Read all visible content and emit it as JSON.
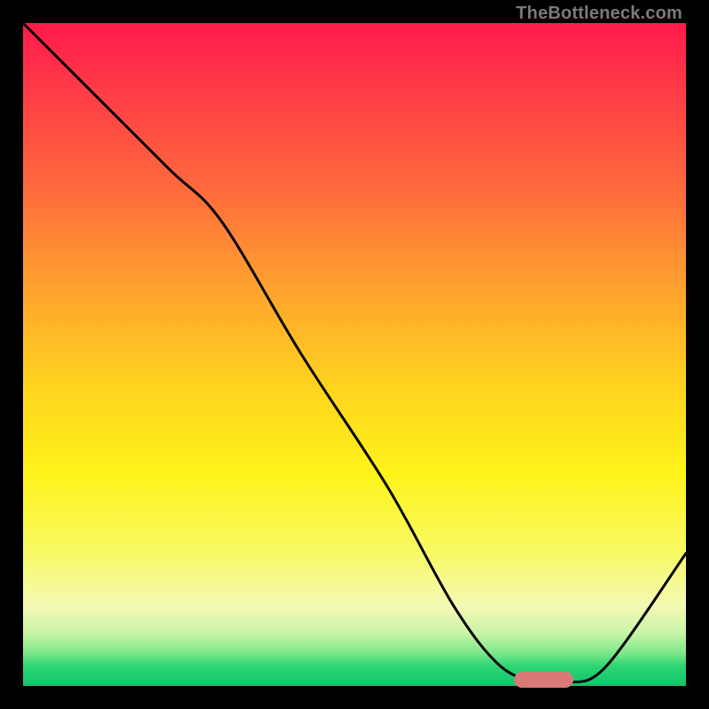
{
  "watermark": "TheBottleneck.com",
  "colors": {
    "frame": "#000000",
    "curve": "#000000",
    "marker": "#d97a78"
  },
  "chart_data": {
    "type": "line",
    "title": "",
    "xlabel": "",
    "ylabel": "",
    "xlim": [
      0,
      100
    ],
    "ylim": [
      0,
      100
    ],
    "grid": false,
    "series": [
      {
        "name": "curve",
        "x": [
          0,
          10,
          22,
          30,
          42,
          55,
          65,
          72,
          78,
          82,
          88,
          100
        ],
        "y": [
          100,
          90,
          78,
          70,
          50,
          30,
          12,
          3,
          0.5,
          0.5,
          3,
          20
        ]
      }
    ],
    "marker": {
      "x_start": 74,
      "x_end": 83,
      "y": 1.0
    },
    "annotations": []
  }
}
